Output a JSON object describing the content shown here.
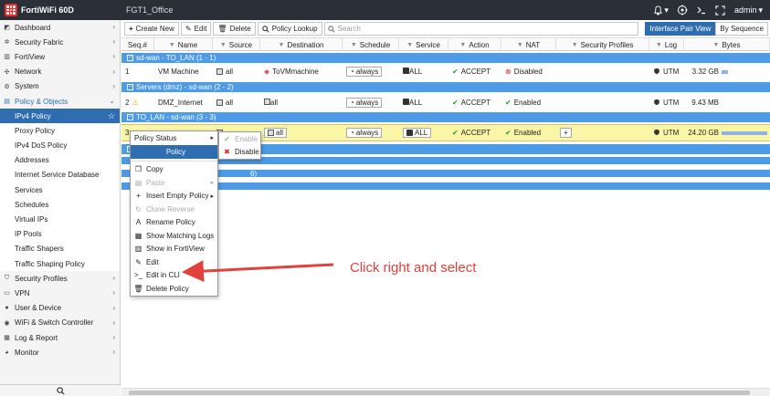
{
  "topbar": {
    "model": "FortiWiFi 60D",
    "hostname": "FGT1_Office",
    "bell_caret": "▾",
    "admin_label": "admin",
    "admin_caret": "▾"
  },
  "sidebar": {
    "items": [
      {
        "label": "Dashboard",
        "icon": "dashboard-icon",
        "glyph": "◩",
        "chevron": "›"
      },
      {
        "label": "Security Fabric",
        "icon": "fabric-icon",
        "glyph": "✲",
        "chevron": "›"
      },
      {
        "label": "FortiView",
        "icon": "fortiview-icon",
        "glyph": "▥",
        "chevron": "›"
      },
      {
        "label": "Network",
        "icon": "network-icon",
        "glyph": "✣",
        "chevron": "›"
      },
      {
        "label": "System",
        "icon": "gear-icon",
        "glyph": "⚙",
        "chevron": "›"
      },
      {
        "label": "Policy & Objects",
        "icon": "policy-icon",
        "glyph": "▤",
        "chevron": "⌄"
      }
    ],
    "subitems": [
      "IPv4 Policy",
      "Proxy Policy",
      "IPv4 DoS Policy",
      "Addresses",
      "Internet Service Database",
      "Services",
      "Schedules",
      "Virtual IPs",
      "IP Pools",
      "Traffic Shapers",
      "Traffic Shaping Policy"
    ],
    "lower_items": [
      {
        "label": "Security Profiles",
        "icon": "shield-icon",
        "glyph": "⛉",
        "chevron": "›"
      },
      {
        "label": "VPN",
        "icon": "vpn-icon",
        "glyph": "▭",
        "chevron": "›"
      },
      {
        "label": "User & Device",
        "icon": "user-icon",
        "glyph": "●",
        "chevron": "›"
      },
      {
        "label": "WiFi & Switch Controller",
        "icon": "wifi-icon",
        "glyph": "◉",
        "chevron": "›"
      },
      {
        "label": "Log & Report",
        "icon": "log-icon",
        "glyph": "▦",
        "chevron": "›"
      },
      {
        "label": "Monitor",
        "icon": "monitor-icon",
        "glyph": "◕",
        "chevron": "›"
      }
    ],
    "star": "☆"
  },
  "toolbar": {
    "create_new": "Create New",
    "edit": "Edit",
    "delete": "Delete",
    "policy_lookup": "Policy Lookup",
    "search_placeholder": "Search",
    "interface_pair_view": "Interface Pair View",
    "by_sequence": "By Sequence"
  },
  "columns": [
    "Seq.#",
    "Name",
    "Source",
    "Destination",
    "Schedule",
    "Service",
    "Action",
    "NAT",
    "Security Profiles",
    "Log",
    "Bytes"
  ],
  "groups": [
    {
      "label": "sd-wan - TO_LAN (1 - 1)"
    },
    {
      "label": "Servers (dmz) - sd-wan (2 - 2)"
    },
    {
      "label": "TO_LAN - sd-wan (3 - 3)"
    }
  ],
  "hidden_group_tail": "6)",
  "rows": [
    {
      "seq": "1",
      "name": "VM Machine",
      "source": "all",
      "destination": "ToVMmachine",
      "schedule": "always",
      "service": "ALL",
      "action": "ACCEPT",
      "nat": "Disabled",
      "log": "UTM",
      "bytes": "3.32 GB",
      "bytes_fraction": 0.14
    },
    {
      "seq": "2",
      "name": "DMZ_Internet",
      "source": "all",
      "destination": "all",
      "schedule": "always",
      "service": "ALL",
      "action": "ACCEPT",
      "nat": "Enabled",
      "log": "UTM",
      "bytes": "9.43 MB",
      "bytes_fraction": 0
    },
    {
      "seq": "3",
      "name": "",
      "source": "",
      "destination": "all",
      "schedule": "always",
      "service": "ALL",
      "action": "ACCEPT",
      "nat": "Enabled",
      "log": "UTM",
      "bytes": "24.20 GB",
      "bytes_fraction": 1.0
    }
  ],
  "context_menu": {
    "items": [
      {
        "label": "Policy Status",
        "disabled": false,
        "submenu": true,
        "icon": ""
      },
      {
        "label": "Policy",
        "disabled": false,
        "submenu": false,
        "icon": "",
        "header": true
      },
      {
        "label": "Copy",
        "disabled": false,
        "submenu": false,
        "icon": "copy-icon",
        "glyph": "❐"
      },
      {
        "label": "Paste",
        "disabled": true,
        "submenu": true,
        "icon": "paste-icon",
        "glyph": "▤"
      },
      {
        "label": "Insert Empty Policy",
        "disabled": false,
        "submenu": true,
        "icon": "plus-icon",
        "glyph": "+"
      },
      {
        "label": "Clone Reverse",
        "disabled": true,
        "submenu": false,
        "icon": "clone-icon",
        "glyph": "↻"
      },
      {
        "label": "Rename Policy",
        "disabled": false,
        "submenu": false,
        "icon": "rename-icon",
        "glyph": "A"
      },
      {
        "label": "Show Matching Logs",
        "disabled": false,
        "submenu": false,
        "icon": "logs-icon",
        "glyph": "▦"
      },
      {
        "label": "Show in FortiView",
        "disabled": false,
        "submenu": false,
        "icon": "fortiview-icon",
        "glyph": "▥"
      },
      {
        "label": "Edit",
        "disabled": false,
        "submenu": false,
        "icon": "pencil-icon",
        "glyph": "✎"
      },
      {
        "label": "Edit in CLI",
        "disabled": false,
        "submenu": false,
        "icon": "cli-icon",
        "glyph": ">_"
      },
      {
        "label": "Delete Policy",
        "disabled": false,
        "submenu": false,
        "icon": "trash-icon",
        "glyph": "🗑"
      }
    ],
    "status_submenu": [
      {
        "label": "Enable",
        "disabled": true,
        "icon": "check-icon",
        "glyph": "✔"
      },
      {
        "label": "Disable",
        "disabled": false,
        "icon": "x-icon",
        "glyph": "✖"
      }
    ]
  },
  "annotation": {
    "text": "Click right and select",
    "color": "#e2413c"
  },
  "colors": {
    "group_bar": "#4d9be6",
    "selected_row": "#faf5a7",
    "sidebar_active": "#2e6eb0",
    "topbar": "#2a2f38"
  }
}
